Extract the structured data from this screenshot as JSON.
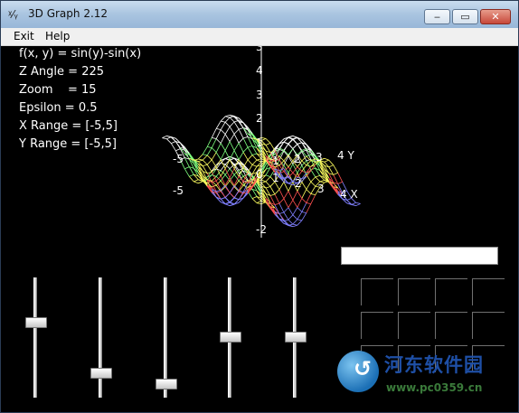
{
  "window": {
    "title": "3D Graph 2.12",
    "app_icon": "xy-icon",
    "app_icon_glyph": "ᵡ⁄ᵧ",
    "controls": {
      "minimize": "‒",
      "maximize": "▭",
      "close": "✕"
    }
  },
  "menu": {
    "items": [
      {
        "label": "Exit"
      },
      {
        "label": "Help"
      }
    ]
  },
  "info": {
    "function": "f(x, y) = sin(y)-sin(x)",
    "z_angle": "Z Angle = 225",
    "zoom": "Zoom    = 15",
    "epsilon": "Epsilon = 0.5",
    "x_range": "X Range = [-5,5]",
    "y_range": "Y Range = [-5,5]"
  },
  "plot": {
    "function": "sin(y)-sin(x)",
    "x_range": [
      -5,
      5
    ],
    "y_range": [
      -5,
      5
    ],
    "z_angle": 225,
    "zoom": 15,
    "axis_labels": {
      "z_ticks": [
        "3",
        "4",
        "3",
        "2",
        "1",
        "0",
        "-2"
      ],
      "x_ticks": [
        "1",
        "2",
        "3",
        "4 X"
      ],
      "y_ticks": [
        "1",
        "2",
        "3",
        "4 Y"
      ],
      "neg_ticks": [
        "-5",
        "-5"
      ]
    },
    "colors": {
      "mesh_top": "#ffffff",
      "mesh_green": "#7fff7f",
      "mesh_red": "#ff5050",
      "mesh_blue": "#8080ff",
      "mesh_yellow": "#ffff60"
    }
  },
  "sliders": [
    {
      "name": "slider-1",
      "level": 0.36
    },
    {
      "name": "slider-2",
      "level": 0.81
    },
    {
      "name": "slider-3",
      "level": 0.91
    },
    {
      "name": "slider-4",
      "level": 0.49
    },
    {
      "name": "slider-5",
      "level": 0.49
    }
  ],
  "text_box": {
    "value": ""
  },
  "watermark": {
    "name_cn": "河东软件园",
    "url": "www.pc0359.cn"
  }
}
